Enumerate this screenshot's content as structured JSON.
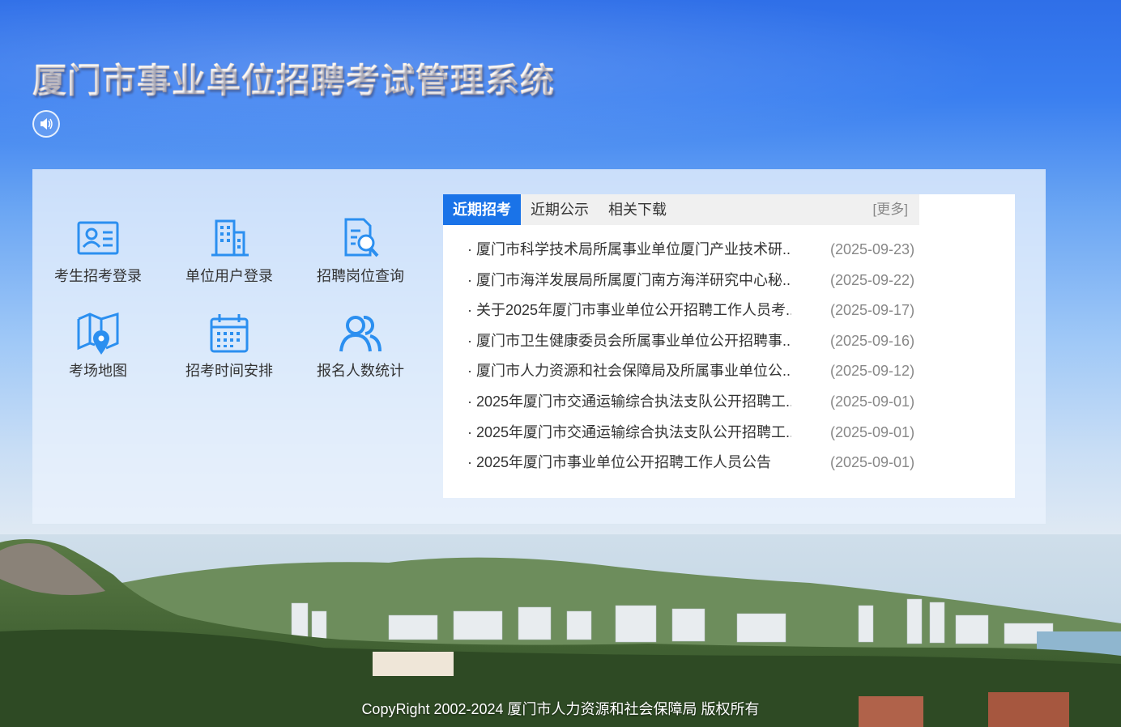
{
  "header": {
    "title": "厦门市事业单位招聘考试管理系统",
    "sound_icon": "speaker-icon"
  },
  "quick_links": [
    {
      "label": "考生招考登录",
      "icon": "id-card-icon"
    },
    {
      "label": "单位用户登录",
      "icon": "building-icon"
    },
    {
      "label": "招聘岗位查询",
      "icon": "document-search-icon"
    },
    {
      "label": "考场地图",
      "icon": "map-pin-icon"
    },
    {
      "label": "招考时间安排",
      "icon": "calendar-icon"
    },
    {
      "label": "报名人数统计",
      "icon": "users-icon"
    }
  ],
  "news": {
    "tabs": [
      "近期招考",
      "近期公示",
      "相关下载"
    ],
    "active_tab": "近期招考",
    "more_label": "[更多]",
    "items": [
      {
        "title": "· 厦门市科学技术局所属事业单位厦门产业技术研...",
        "date": "(2025-09-23)"
      },
      {
        "title": "· 厦门市海洋发展局所属厦门南方海洋研究中心秘...",
        "date": "(2025-09-22)"
      },
      {
        "title": "· 关于2025年厦门市事业单位公开招聘工作人员考...",
        "date": "(2025-09-17)"
      },
      {
        "title": "· 厦门市卫生健康委员会所属事业单位公开招聘事...",
        "date": "(2025-09-16)"
      },
      {
        "title": "· 厦门市人力资源和社会保障局及所属事业单位公...",
        "date": "(2025-09-12)"
      },
      {
        "title": "· 2025年厦门市交通运输综合执法支队公开招聘工...",
        "date": "(2025-09-01)"
      },
      {
        "title": "· 2025年厦门市交通运输综合执法支队公开招聘工...",
        "date": "(2025-09-01)"
      },
      {
        "title": "· 2025年厦门市事业单位公开招聘工作人员公告",
        "date": "(2025-09-01)"
      }
    ]
  },
  "footer": {
    "copyright": "CopyRight 2002-2024 厦门市人力资源和社会保障局 版权所有"
  },
  "colors": {
    "accent": "#1a73e8",
    "icon_blue": "#2b8ff0",
    "title_orange": "#f0a25a"
  }
}
